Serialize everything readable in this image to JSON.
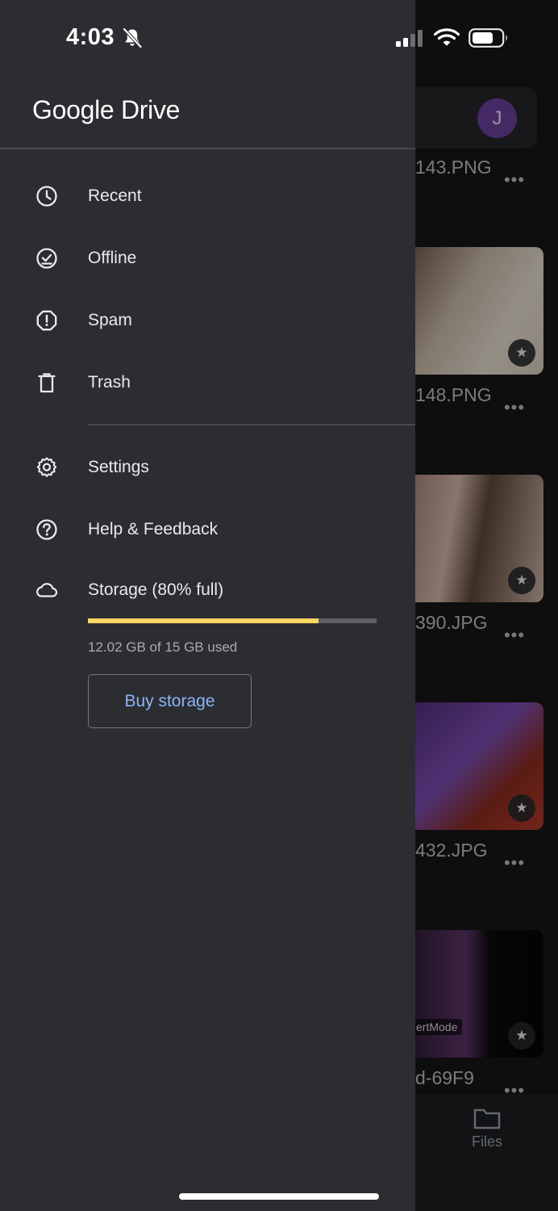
{
  "status_bar": {
    "time": "4:03",
    "icons": [
      "bell-slash-icon",
      "cellular-signal-icon",
      "wifi-icon",
      "battery-icon"
    ]
  },
  "background_app": {
    "account_initial": "J",
    "files": [
      {
        "name": "143.PNG",
        "starred": false
      },
      {
        "name": "148.PNG",
        "starred": true
      },
      {
        "name": "390.JPG",
        "starred": true
      },
      {
        "name": "432.JPG",
        "starred": true
      },
      {
        "name": "d-69F9",
        "starred": true
      }
    ],
    "thumbnail_watermark": "ertMode",
    "more_label": "•••",
    "star_glyph": "★",
    "bottom_nav": {
      "files_label": "Files"
    }
  },
  "drawer": {
    "brand": {
      "part1": "Google",
      "part2": " Drive"
    },
    "items": [
      {
        "label": "Recent",
        "icon": "clock-icon"
      },
      {
        "label": "Offline",
        "icon": "offline-check-icon"
      },
      {
        "label": "Spam",
        "icon": "spam-alert-icon"
      },
      {
        "label": "Trash",
        "icon": "trash-icon"
      },
      {
        "label": "Settings",
        "icon": "gear-icon"
      },
      {
        "label": "Help & Feedback",
        "icon": "help-icon"
      }
    ],
    "storage": {
      "label": "Storage (80% full)",
      "icon": "cloud-icon",
      "used_text": "12.02 GB of 15 GB used",
      "fraction_used": 0.8,
      "bar_color": "#fdd663",
      "buy_label": "Buy storage"
    }
  },
  "colors": {
    "drawer_bg": "#2c2d31",
    "accent_link": "#8ab4f8",
    "avatar_bg": "#6b3f9c"
  }
}
